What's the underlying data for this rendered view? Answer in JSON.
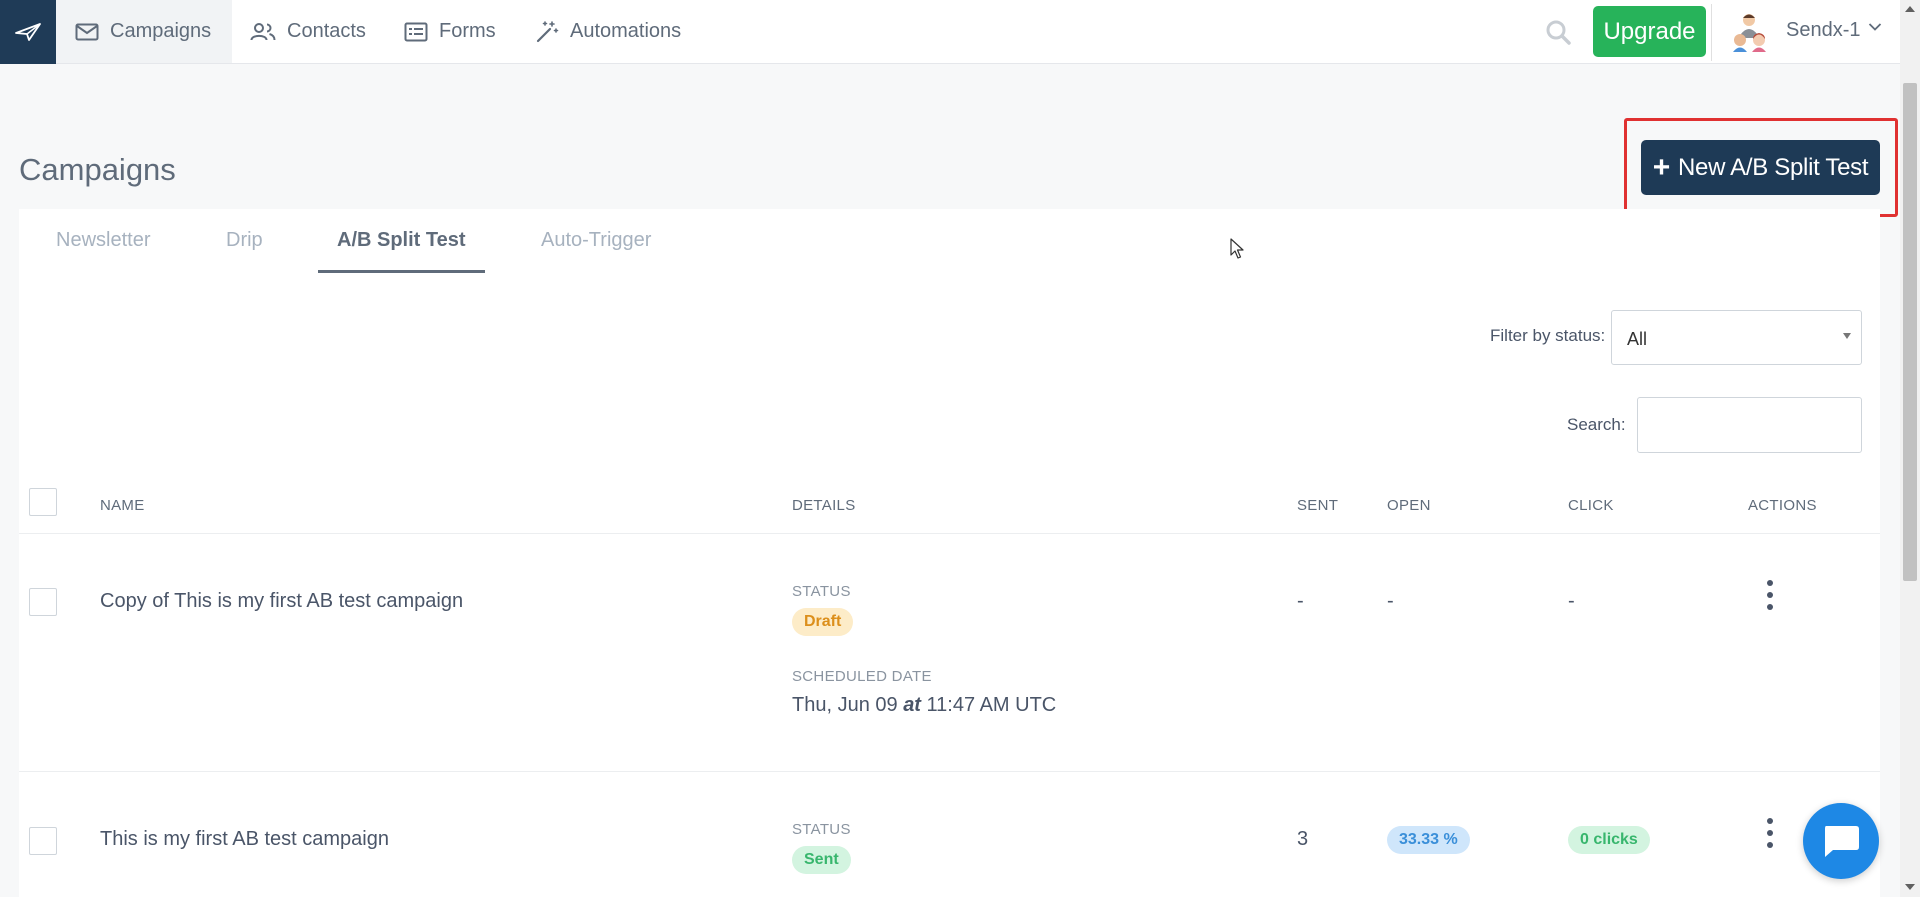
{
  "nav": {
    "items": [
      {
        "label": "Campaigns",
        "icon": "envelope-icon"
      },
      {
        "label": "Contacts",
        "icon": "users-icon"
      },
      {
        "label": "Forms",
        "icon": "form-icon"
      },
      {
        "label": "Automations",
        "icon": "magic-wand-icon"
      }
    ],
    "upgrade_label": "Upgrade",
    "account_name": "Sendx-1"
  },
  "page": {
    "title": "Campaigns",
    "new_button_label": "New A/B Split Test"
  },
  "tabs": [
    {
      "label": "Newsletter"
    },
    {
      "label": "Drip"
    },
    {
      "label": "A/B Split Test",
      "active": true
    },
    {
      "label": "Auto-Trigger"
    }
  ],
  "filter": {
    "label": "Filter by status:",
    "value": "All"
  },
  "search": {
    "label": "Search:",
    "value": ""
  },
  "table": {
    "headers": [
      "NAME",
      "DETAILS",
      "SENT",
      "OPEN",
      "CLICK",
      "ACTIONS"
    ],
    "rows": [
      {
        "name": "Copy of This is my first AB test campaign",
        "status_label": "STATUS",
        "status": "Draft",
        "scheduled_label": "SCHEDULED DATE",
        "scheduled_date": "Thu, Jun 09",
        "scheduled_at": "at",
        "scheduled_time": "11:47 AM UTC",
        "sent": "-",
        "open": "-",
        "click": "-"
      },
      {
        "name": "This is my first AB test campaign",
        "status_label": "STATUS",
        "status": "Sent",
        "sent": "3",
        "open": "33.33 %",
        "click": "0 clicks"
      }
    ]
  },
  "colors": {
    "brand_dark": "#1e3a56",
    "upgrade_green": "#27b35a",
    "highlight_red": "#e03131",
    "chat_blue": "#1e88e5"
  }
}
